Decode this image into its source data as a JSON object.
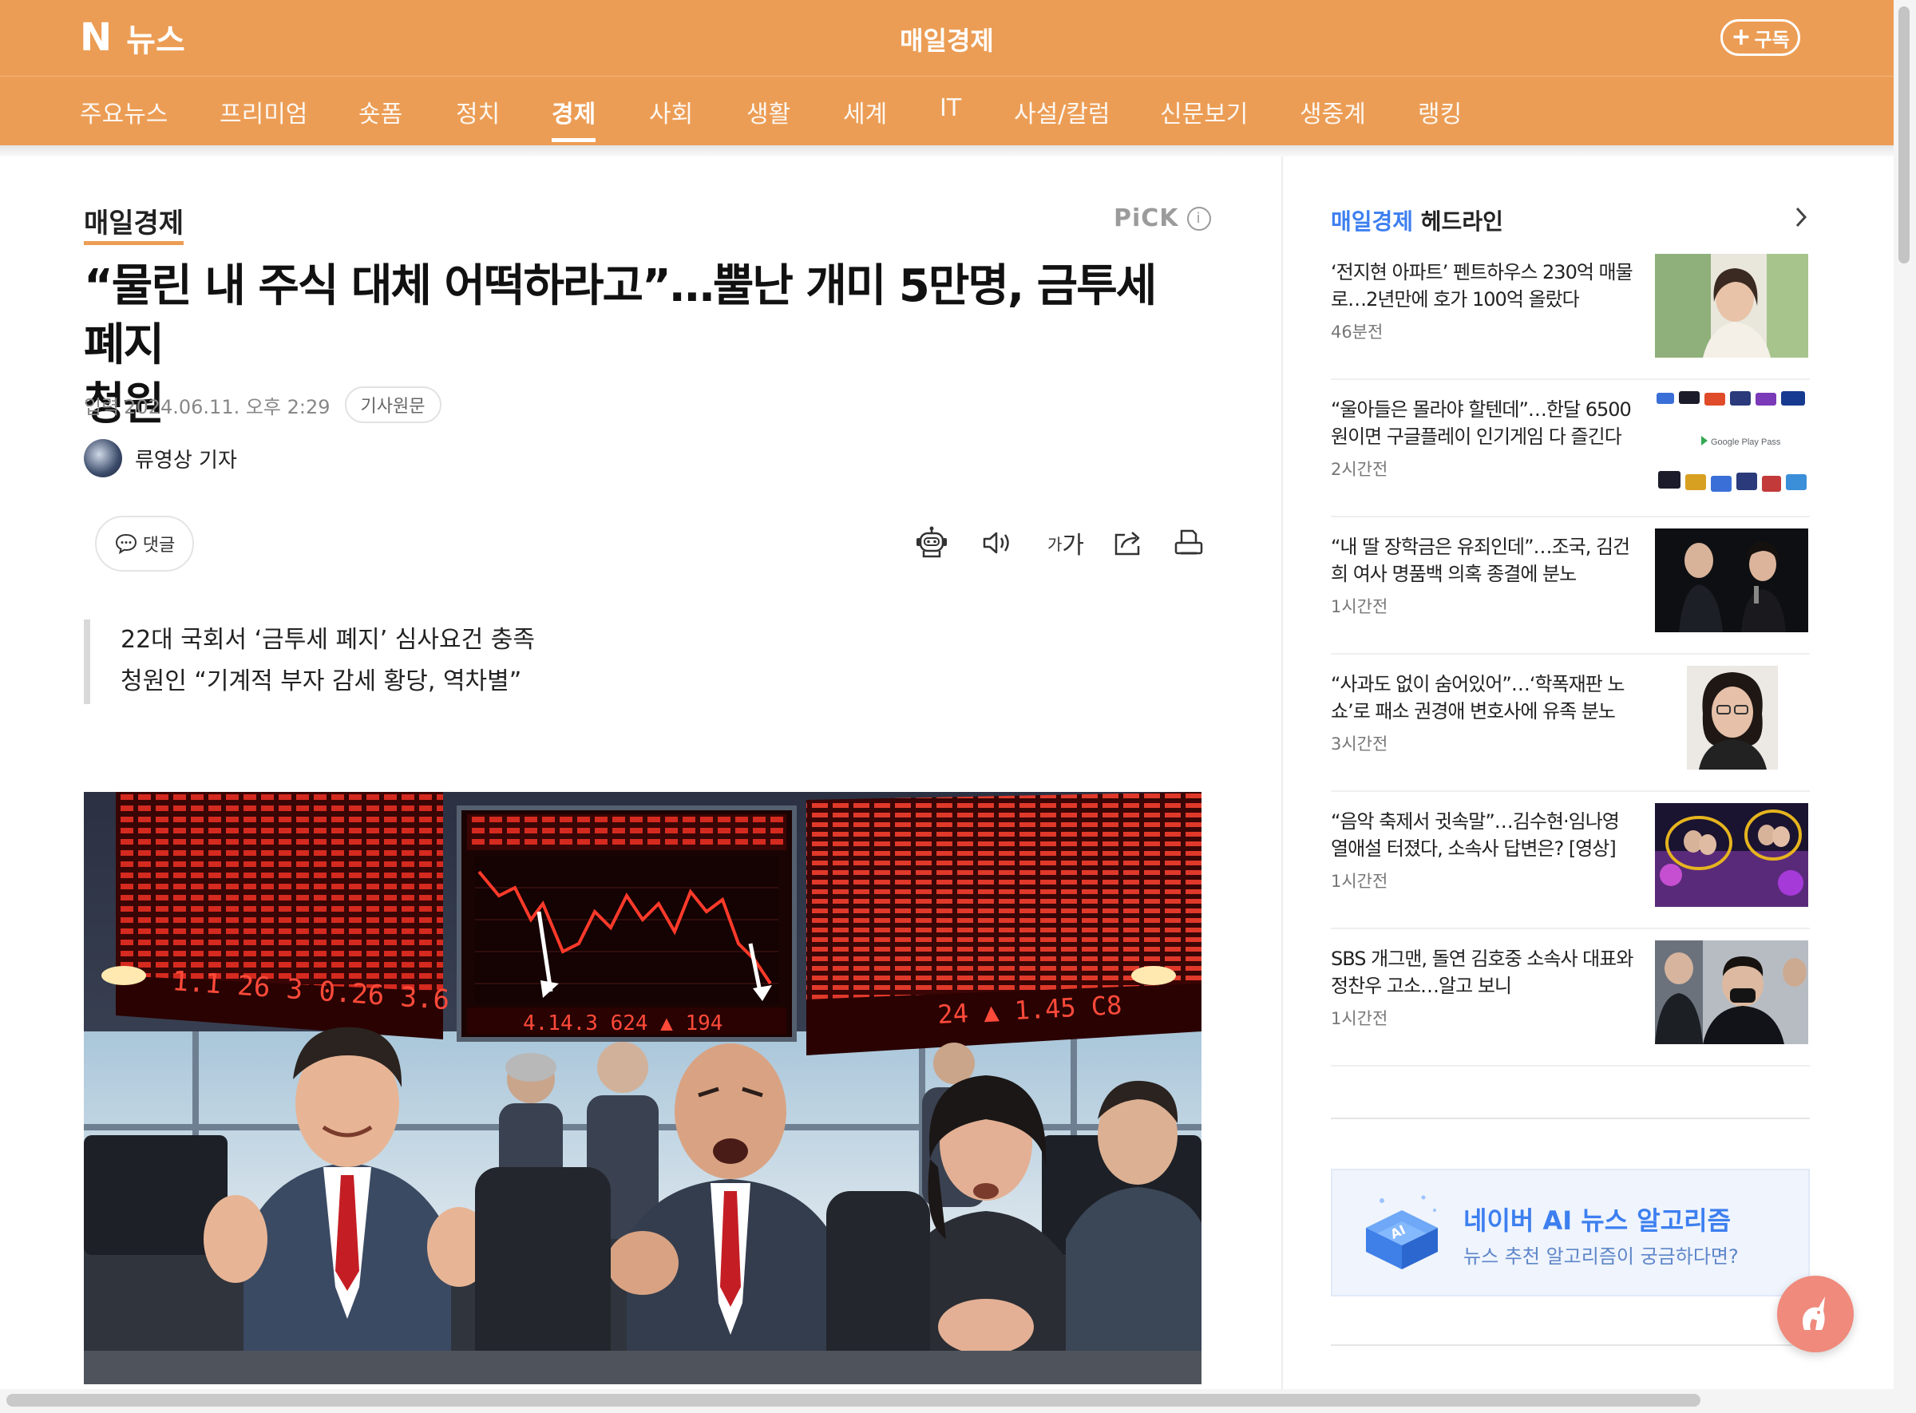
{
  "header": {
    "logo_letter": "N",
    "logo_text": "뉴스",
    "press_title": "매일경제",
    "subscribe_label": "구독",
    "subscribe_icon": "plus-icon",
    "brand_color": "#ec9d55"
  },
  "nav": {
    "items": [
      {
        "label": "주요뉴스"
      },
      {
        "label": "프리미엄"
      },
      {
        "label": "숏폼"
      },
      {
        "label": "정치"
      },
      {
        "label": "경제"
      },
      {
        "label": "사회"
      },
      {
        "label": "생활"
      },
      {
        "label": "세계"
      },
      {
        "label": "IT"
      },
      {
        "label": "사설/칼럼"
      },
      {
        "label": "신문보기"
      },
      {
        "label": "생중계"
      },
      {
        "label": "랭킹"
      }
    ],
    "active": "경제"
  },
  "article": {
    "press_name": "매일경제",
    "pick_label": "PiCK",
    "pick_info_icon": "info-icon",
    "headline_line1": "“물린 내 주식 대체 어떡하라고”…뿔난 개미 5만명, 금투세 폐지",
    "headline_line2": "청원",
    "date_label": "입력",
    "date": "2024.06.11. 오후 2:29",
    "origin_label": "기사원문",
    "reporter": "류영상 기자",
    "comment_label": "댓글",
    "tools": [
      {
        "icon": "robot-summary-icon"
      },
      {
        "icon": "speaker-icon"
      },
      {
        "icon": "font-size-icon",
        "text": "가가"
      },
      {
        "icon": "share-icon"
      },
      {
        "icon": "print-icon"
      }
    ],
    "summary": [
      "22대 국회서 ‘금투세 폐지’ 심사요건 충족",
      "청원인 “기계적 부자 감세 황당, 역차별”"
    ],
    "photo_board_texts": {
      "left": "1.1 26 3 0.26 3.6",
      "center": "4.14.3 624 ▲ 194",
      "right": "24 ▲ 1.45 C8"
    }
  },
  "sidebar": {
    "title_press": "매일경제",
    "title_suffix": "헤드라인",
    "chevron_icon": "chevron-right-icon",
    "items": [
      {
        "title": "‘전지현 아파트’ 펜트하우스 230억 매물로…2년만에 호가 100억 올랐다",
        "time": "46분전"
      },
      {
        "title": "“울아들은 몰라야 할텐데”…한달 6500원이면 구글플레이 인기게임 다 즐긴다",
        "time": "2시간전",
        "thumb_text": "Google Play Pass"
      },
      {
        "title": "“내 딸 장학금은 유죄인데”…조국, 김건희 여사 명품백 의혹 종결에 분노",
        "time": "1시간전"
      },
      {
        "title": "“사과도 없이 숨어있어”…‘학폭재판 노쇼’로 패소 권경애 변호사에 유족 분노",
        "time": "3시간전"
      },
      {
        "title": "“음악 축제서 귓속말”…김수현·임나영 열애설 터졌다, 소속사 답변은? [영상]",
        "time": "1시간전"
      },
      {
        "title": "SBS 개그맨, 돌연 김호중 소속사 대표와 정찬우 고소…알고 보니",
        "time": "1시간전"
      }
    ],
    "ai_banner": {
      "title": "네이버 AI 뉴스 알고리즘",
      "subtitle": "뉴스 추천 알고리즘이 궁금하다면?",
      "cube_label": "AI"
    }
  },
  "float_button": {
    "icon": "unicorn-icon",
    "color": "#ef8a7c"
  }
}
